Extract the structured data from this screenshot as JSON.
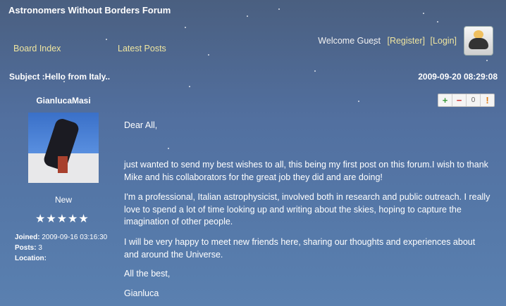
{
  "header": {
    "title": "Astronomers Without Borders Forum",
    "nav": {
      "board_index": "Board Index",
      "latest_posts": "Latest Posts"
    },
    "welcome": "Welcome Guest",
    "register": "[Register]",
    "login": "[Login]",
    "avatar_icon": "guest-user-icon"
  },
  "post": {
    "subject": "Subject :Hello from Italy..",
    "date": "2009-09-20 08:29:08",
    "actions": {
      "plus": "+",
      "minus": "−",
      "count": "0",
      "report": "!"
    },
    "author": {
      "username": "GianlucaMasi",
      "rank": "New",
      "stars": "★★★★★",
      "joined_label": "Joined:",
      "joined_value": "2009-09-16 03:16:30",
      "posts_label": "Posts:",
      "posts_value": "3",
      "location_label": "Location:",
      "location_value": ""
    },
    "body": [
      "Dear All,",
      "just wanted to send my best wishes to all, this being my first post on this forum.I wish to thank Mike and his collaborators for the great job they did and are doing!",
      "I'm a professional, Italian astrophysicist, involved both in research and public outreach. I really love to spend a lot of time looking up and writing about the skies, hoping to capture the imagination of other people.",
      "I will be very happy to meet new friends here, sharing our thoughts and experiences about and around the Universe.",
      "All the best,",
      "Gianluca"
    ]
  }
}
